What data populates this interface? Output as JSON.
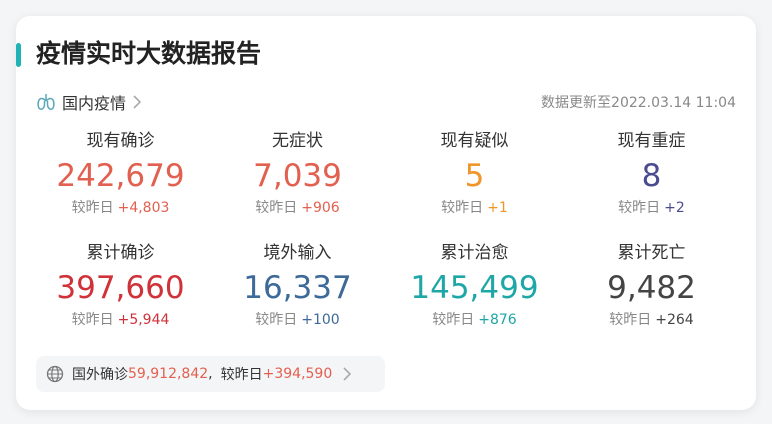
{
  "header": {
    "title": "疫情实时大数据报告",
    "section_label": "国内疫情",
    "updated": "数据更新至2022.03.14 11:04"
  },
  "colors": {
    "accent": "#1fb3b6",
    "orange_red": "#e2604f",
    "orange": "#f0952a",
    "purple": "#4b4b8f",
    "red": "#d0323a",
    "blue": "#3d6a99",
    "teal": "#1fa6a6",
    "dark": "#444444"
  },
  "stats": [
    {
      "name": "现有确诊",
      "value": "242,679",
      "delta_label": "较昨日",
      "delta": "+4,803",
      "color": "#e2604f"
    },
    {
      "name": "无症状",
      "value": "7,039",
      "delta_label": "较昨日",
      "delta": "+906",
      "color": "#e2604f"
    },
    {
      "name": "现有疑似",
      "value": "5",
      "delta_label": "较昨日",
      "delta": "+1",
      "color": "#f0952a"
    },
    {
      "name": "现有重症",
      "value": "8",
      "delta_label": "较昨日",
      "delta": "+2",
      "color": "#4b4b8f"
    },
    {
      "name": "累计确诊",
      "value": "397,660",
      "delta_label": "较昨日",
      "delta": "+5,944",
      "color": "#d0323a"
    },
    {
      "name": "境外输入",
      "value": "16,337",
      "delta_label": "较昨日",
      "delta": "+100",
      "color": "#3d6a99"
    },
    {
      "name": "累计治愈",
      "value": "145,499",
      "delta_label": "较昨日",
      "delta": "+876",
      "color": "#1fa6a6"
    },
    {
      "name": "累计死亡",
      "value": "9,482",
      "delta_label": "较昨日",
      "delta": "+264",
      "color": "#444444"
    }
  ],
  "foreign": {
    "label": "国外确诊",
    "value": "59,912,842",
    "sep": ",",
    "delta_label": "较昨日",
    "delta": "+394,590"
  },
  "icons": {
    "section": "lungs-icon",
    "chevron": "chevron-right-icon",
    "foreign": "globe-icon"
  }
}
